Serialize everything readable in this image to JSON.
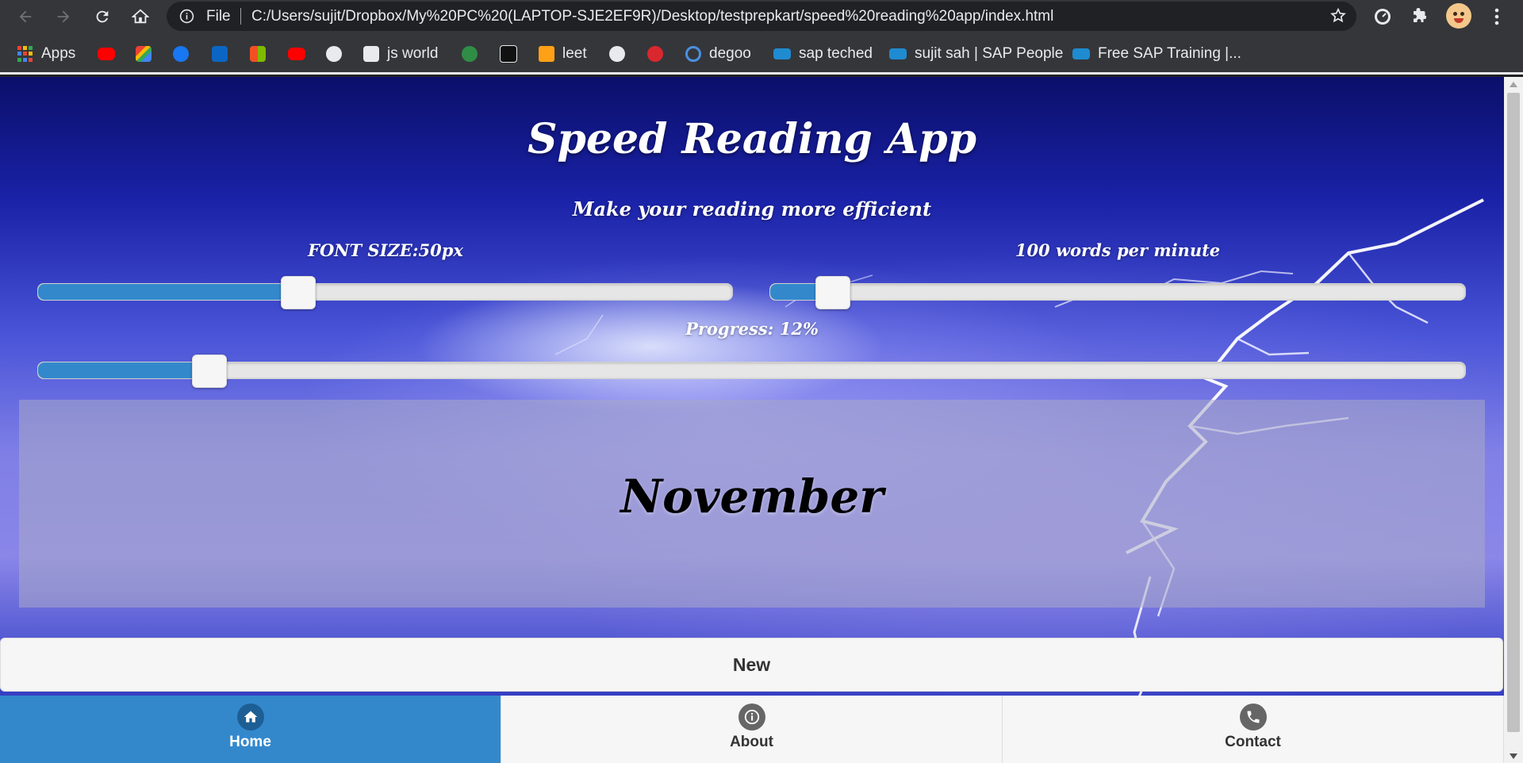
{
  "browser": {
    "url_scheme": "File",
    "url": "C:/Users/sujit/Dropbox/My%20PC%20(LAPTOP-SJE2EF9R)/Desktop/testprepkart/speed%20reading%20app/index.html",
    "bookmarks": [
      {
        "label": "Apps",
        "icon": "apps-grid-icon"
      },
      {
        "label": "",
        "icon": "youtube-icon"
      },
      {
        "label": "",
        "icon": "gmail-icon"
      },
      {
        "label": "",
        "icon": "facebook-icon"
      },
      {
        "label": "",
        "icon": "linkedin-icon"
      },
      {
        "label": "",
        "icon": "microsoft-icon"
      },
      {
        "label": "",
        "icon": "youtube-icon"
      },
      {
        "label": "",
        "icon": "github-icon"
      },
      {
        "label": "js world",
        "icon": "search-icon"
      },
      {
        "label": "",
        "icon": "geeksforgeeks-icon"
      },
      {
        "label": "",
        "icon": "hackerrank-icon"
      },
      {
        "label": "leet",
        "icon": "leetcode-icon"
      },
      {
        "label": "",
        "icon": "globe-icon"
      },
      {
        "label": "",
        "icon": "mega-icon"
      },
      {
        "label": "degoo",
        "icon": "degoo-icon"
      },
      {
        "label": "sap teched",
        "icon": "sap-icon"
      },
      {
        "label": "sujit sah | SAP People",
        "icon": "sap-icon"
      },
      {
        "label": "Free SAP Training |...",
        "icon": "sap-icon"
      }
    ]
  },
  "app": {
    "title": "Speed Reading App",
    "subtitle": "Make your reading more efficient",
    "font_size_label": "FONT SIZE:50px",
    "font_size_fraction": 0.375,
    "wpm_label": "100 words per minute",
    "wpm_fraction": 0.09,
    "progress_label": "Progress: 12%",
    "progress_fraction": 0.12,
    "current_word": "November",
    "new_button": "New"
  },
  "navbar": {
    "items": [
      {
        "label": "Home",
        "icon": "home-icon",
        "active": true
      },
      {
        "label": "About",
        "icon": "info-icon",
        "active": false
      },
      {
        "label": "Contact",
        "icon": "phone-icon",
        "active": false
      }
    ]
  },
  "colors": {
    "accent": "#3388cc",
    "chrome_bg": "#35363a",
    "nav_bg": "#f6f6f6"
  }
}
